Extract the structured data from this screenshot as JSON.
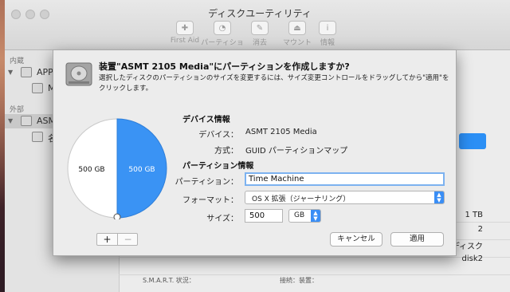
{
  "window": {
    "title": "ディスクユーティリティ"
  },
  "toolbar": {
    "items": [
      {
        "label": "First Aid",
        "icon": "stethoscope-icon"
      },
      {
        "label": "パーティション",
        "icon": "partition-icon"
      },
      {
        "label": "消去",
        "icon": "erase-icon"
      },
      {
        "label": "マウント",
        "icon": "mount-icon"
      },
      {
        "label": "情報",
        "icon": "info-icon"
      }
    ]
  },
  "sidebar": {
    "internal_header": "内蔵",
    "external_header": "外部",
    "items": [
      {
        "label": "APP",
        "level": 0
      },
      {
        "label": "M",
        "level": 1
      },
      {
        "label": "ASM",
        "level": 0
      },
      {
        "label": "名",
        "level": 1
      }
    ]
  },
  "info_table": {
    "values": [
      "1 TB",
      "2",
      "ディスク",
      "disk2"
    ],
    "smart_label": "S.M.A.R.T. 状況：",
    "connection_label": "接続：装置："
  },
  "sheet": {
    "title": "装置\"ASMT 2105 Media\"にパーティションを作成しますか?",
    "description": "選択したディスクのパーティションのサイズを変更するには、サイズ変更コントロールをドラッグしてから\"適用\"をクリックします。",
    "pie": {
      "left_label": "500 GB",
      "right_label": "500 GB",
      "colors": {
        "existing": "#ffffff",
        "new": "#3a93f4"
      }
    },
    "device_info": {
      "title": "デバイス情報",
      "device_label": "デバイス：",
      "device_value": "ASMT 2105 Media",
      "scheme_label": "方式：",
      "scheme_value": "GUID パーティションマップ"
    },
    "partition_info": {
      "title": "パーティション情報",
      "name_label": "パーティション：",
      "name_value": "Time Machine",
      "format_label": "フォーマット：",
      "format_value": "OS X 拡張（ジャーナリング）",
      "size_label": "サイズ：",
      "size_value": "500",
      "size_unit": "GB"
    },
    "buttons": {
      "add": "+",
      "remove": "−",
      "cancel": "キャンセル",
      "apply": "適用"
    }
  }
}
